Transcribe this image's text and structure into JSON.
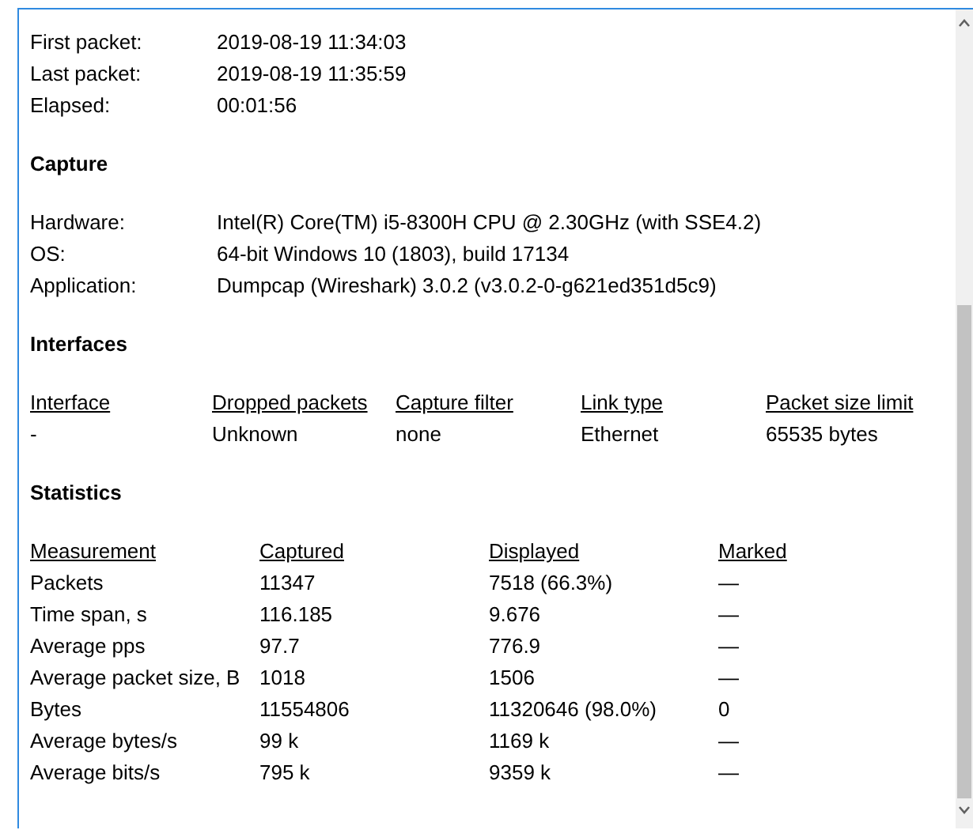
{
  "sections": [
    {
      "kind": "info",
      "rows": [
        {
          "label": "First packet:",
          "value": "2019-08-19 11:34:03"
        },
        {
          "label": "Last packet:",
          "value": "2019-08-19 11:35:59"
        },
        {
          "label": "Elapsed:",
          "value": "00:01:56"
        }
      ]
    },
    {
      "kind": "info",
      "title": "Capture",
      "rows": [
        {
          "label": "Hardware:",
          "value": "Intel(R) Core(TM) i5-8300H CPU @ 2.30GHz (with SSE4.2)"
        },
        {
          "label": "OS:",
          "value": "64-bit Windows 10 (1803), build 17134"
        },
        {
          "label": "Application:",
          "value": "Dumpcap (Wireshark) 3.0.2 (v3.0.2-0-g621ed351d5c9)"
        }
      ]
    },
    {
      "kind": "table",
      "title": "Interfaces",
      "columns": [
        "Interface",
        "Dropped packets",
        "Capture filter",
        "Link type",
        "Packet size limit"
      ],
      "rows": [
        [
          "-",
          "Unknown",
          "none",
          "Ethernet",
          "65535 bytes"
        ]
      ]
    },
    {
      "kind": "table",
      "title": "Statistics",
      "columns": [
        "Measurement",
        "Captured",
        "Displayed",
        "Marked"
      ],
      "rows": [
        [
          "Packets",
          "11347",
          "7518 (66.3%)",
          "—"
        ],
        [
          "Time span, s",
          "116.185",
          "9.676",
          "—"
        ],
        [
          "Average pps",
          "97.7",
          "776.9",
          "—"
        ],
        [
          "Average packet size, B",
          "1018",
          "1506",
          "—"
        ],
        [
          "Bytes",
          "11554806",
          "11320646 (98.0%)",
          "0"
        ],
        [
          "Average bytes/s",
          "99 k",
          "1169 k",
          "—"
        ],
        [
          "Average bits/s",
          "795 k",
          "9359 k",
          "—"
        ]
      ]
    }
  ]
}
